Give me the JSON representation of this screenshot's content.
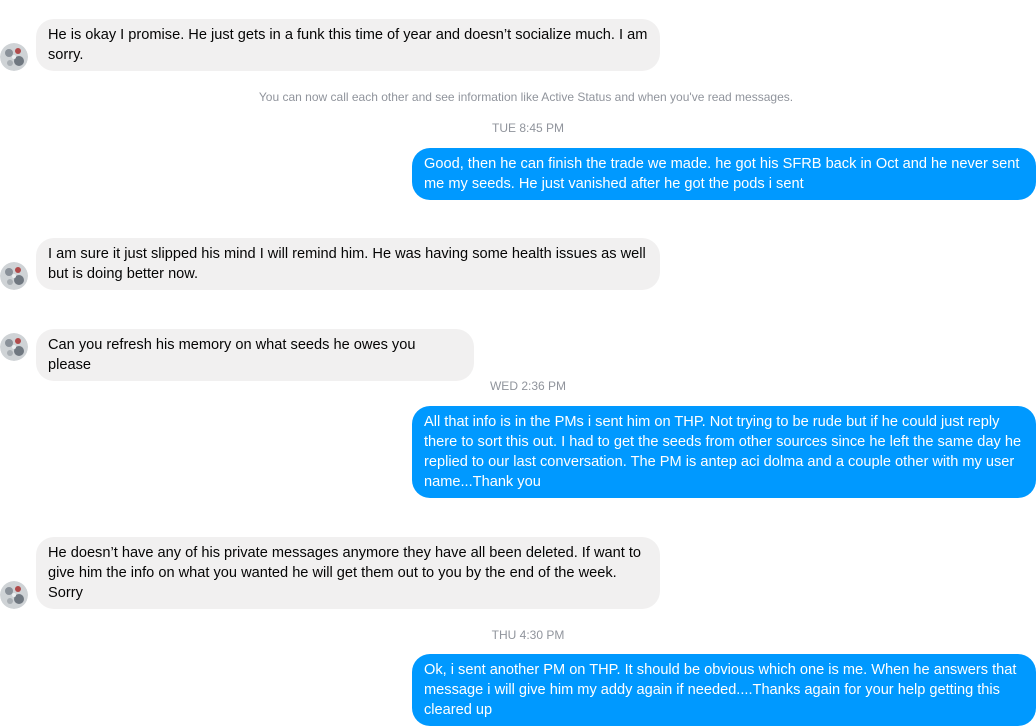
{
  "conversation": {
    "system_notice": "You can now call each other and see information like Active Status and when you've read messages.",
    "timestamps": [
      "TUE 8:45 PM",
      "WED 2:36 PM",
      "THU 4:30 PM"
    ],
    "messages": [
      {
        "direction": "incoming",
        "text": "He is okay I promise. He just gets in a funk this time of year and doesn’t socialize much. I am sorry."
      },
      {
        "direction": "outgoing",
        "text": "Good, then he can finish the trade we made. he got his SFRB back in Oct and he never sent me my seeds. He just vanished after he got the pods i sent"
      },
      {
        "direction": "incoming",
        "text": "I am sure it just slipped his mind I will remind him. He was having some health issues as well but is doing better now."
      },
      {
        "direction": "incoming",
        "text": "Can you refresh his memory on what seeds he owes you please"
      },
      {
        "direction": "outgoing",
        "text": "All that info is in the PMs i sent him on THP. Not trying to be rude but if he could just reply there to sort this out. I had to get the seeds from other sources since he left the same day he replied to our last conversation. The PM is antep aci dolma and a couple other with my user name...Thank you"
      },
      {
        "direction": "incoming",
        "text": "He doesn’t have any of his private messages anymore they have all been deleted. If want to give him the info on what you wanted he will get them out to you by the end of the week. Sorry"
      },
      {
        "direction": "outgoing",
        "text": "Ok, i sent another PM on THP. It should be obvious which one is me. When he answers that message i will give him my addy again if needed....Thanks again for your help getting this cleared up"
      }
    ]
  },
  "colors": {
    "incoming_bubble": "#f1f0f0",
    "outgoing_bubble": "#0099ff",
    "meta_text": "#90949c"
  },
  "icons": {
    "avatar": "contact-avatar-icon"
  }
}
